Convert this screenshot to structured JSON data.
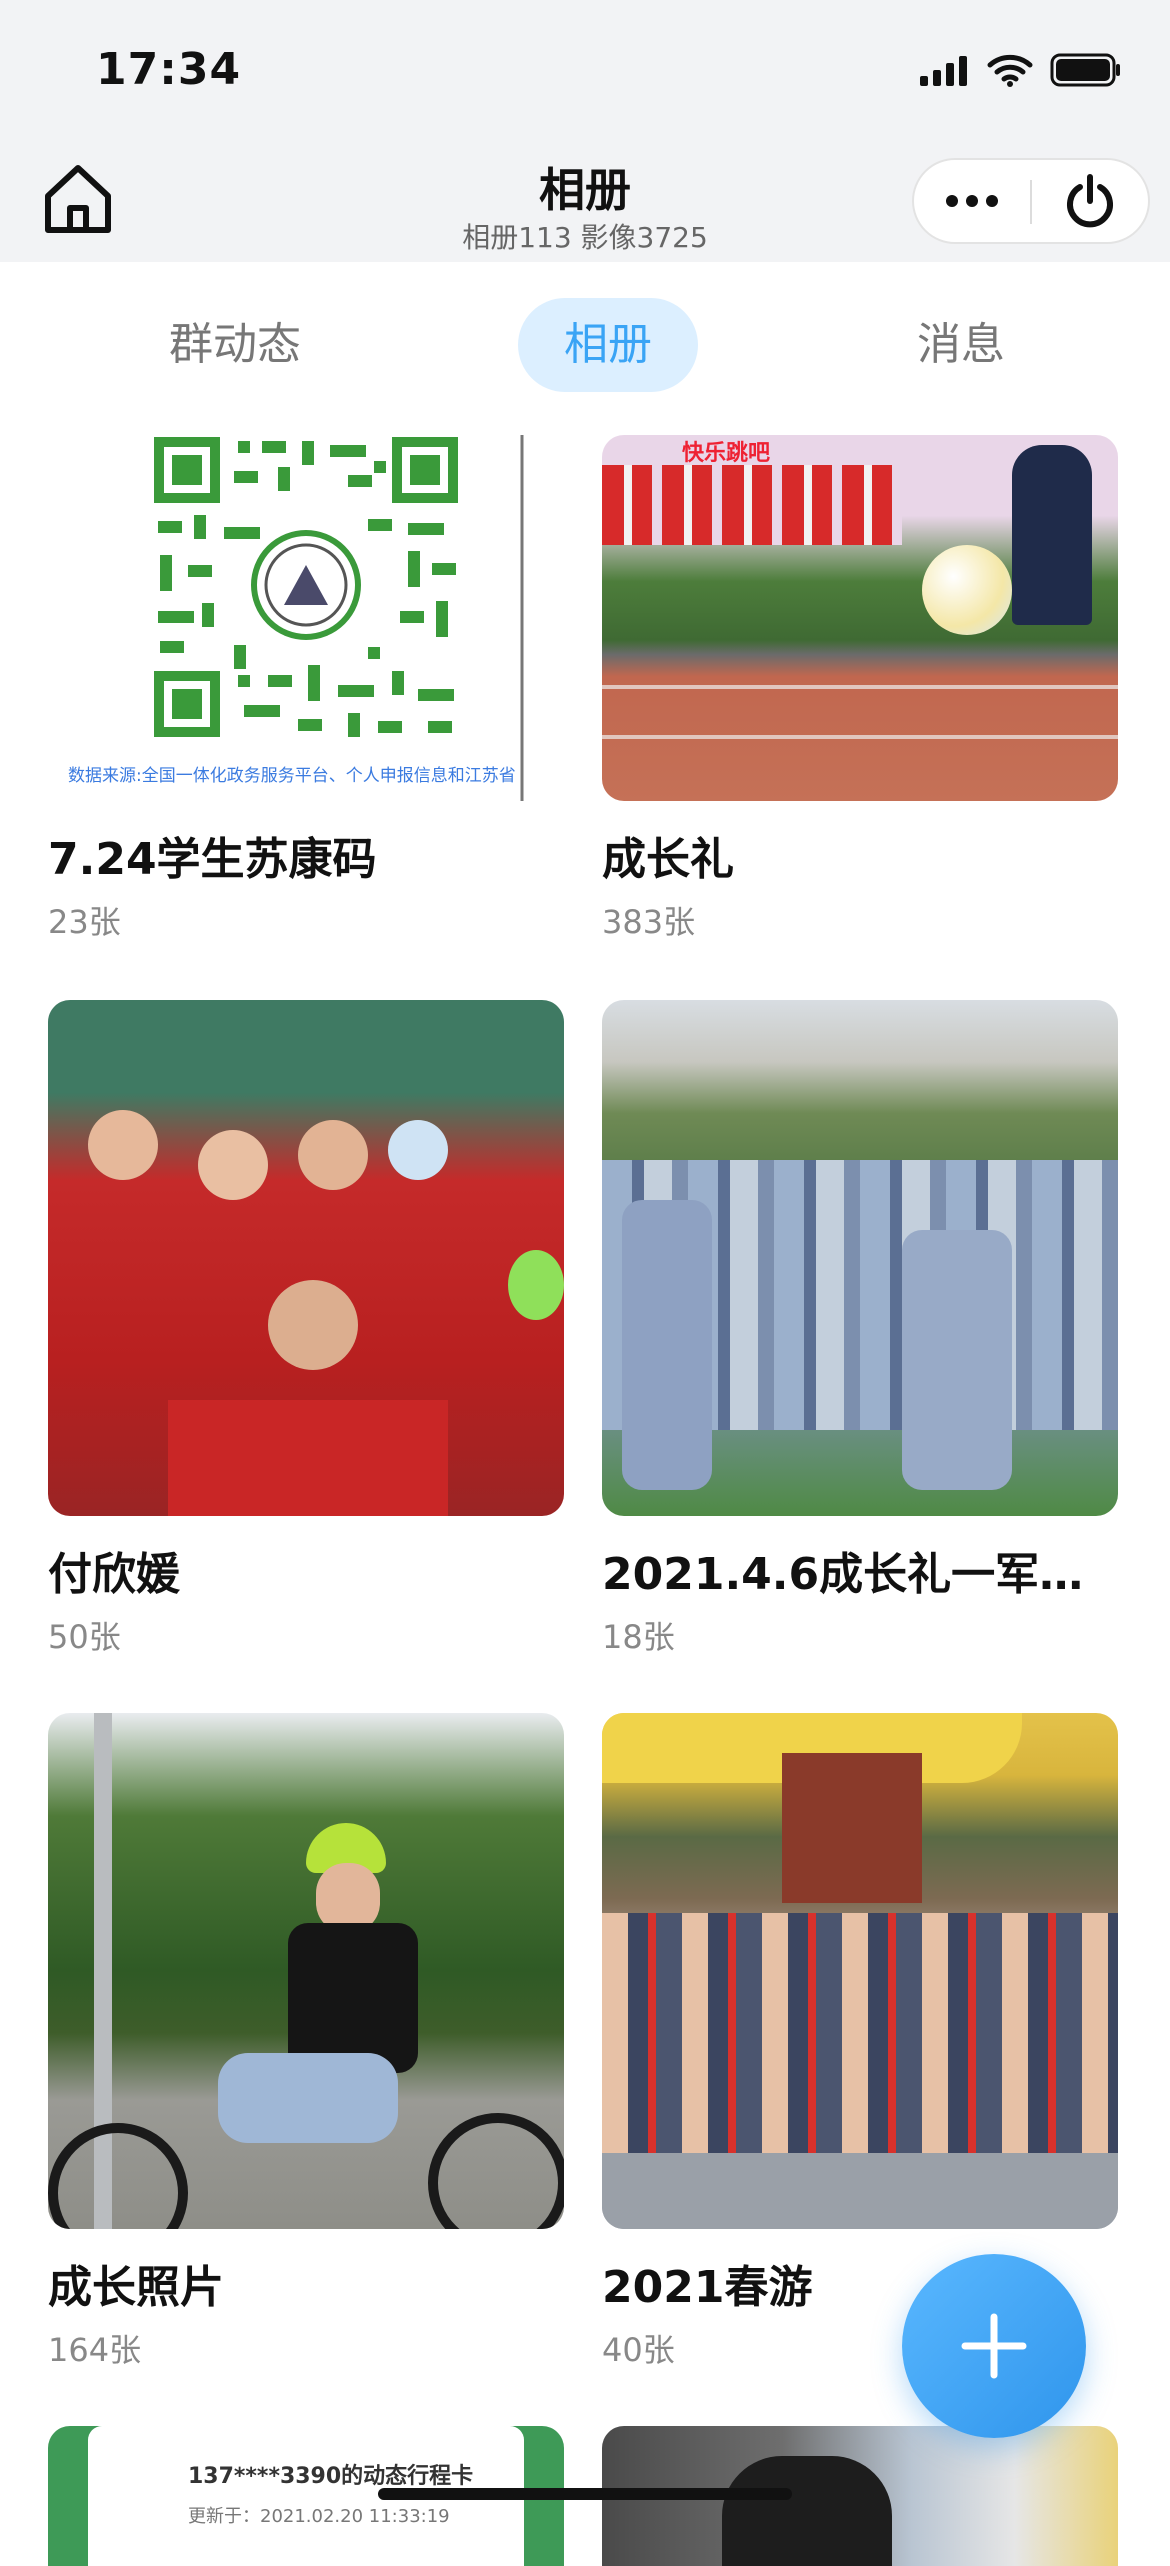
{
  "status_bar": {
    "time": "17:34"
  },
  "header": {
    "title": "相册",
    "subtitle": "相册113 影像3725",
    "home_icon": "home-icon",
    "more_icon": "more-dots-icon",
    "power_icon": "power-icon"
  },
  "tabs": [
    {
      "label": "群动态",
      "active": false
    },
    {
      "label": "相册",
      "active": true
    },
    {
      "label": "消息",
      "active": false
    }
  ],
  "albums": [
    {
      "title": "7.24学生苏康码",
      "count": "23张",
      "caption": "数据来源:全国一体化政务服务平台、个人申报信息和江苏省"
    },
    {
      "title": "成长礼",
      "count": "383张",
      "caption": "快乐跳吧"
    },
    {
      "title": "付欣媛",
      "count": "50张"
    },
    {
      "title": "2021.4.6成长礼一军…",
      "count": "18张"
    },
    {
      "title": "成长照片",
      "count": "164张"
    },
    {
      "title": "2021春游",
      "count": "40张"
    },
    {
      "title": "",
      "count": "",
      "caption": "137****3390的动态行程卡",
      "caption2": "更新于：2021.02.20 11:33:19"
    },
    {
      "title": "",
      "count": ""
    }
  ],
  "colors": {
    "accent": "#3aa4f5",
    "tab_active_bg": "#dcefff",
    "fab": "#2f95ec"
  },
  "fab": {
    "icon": "plus-icon"
  }
}
